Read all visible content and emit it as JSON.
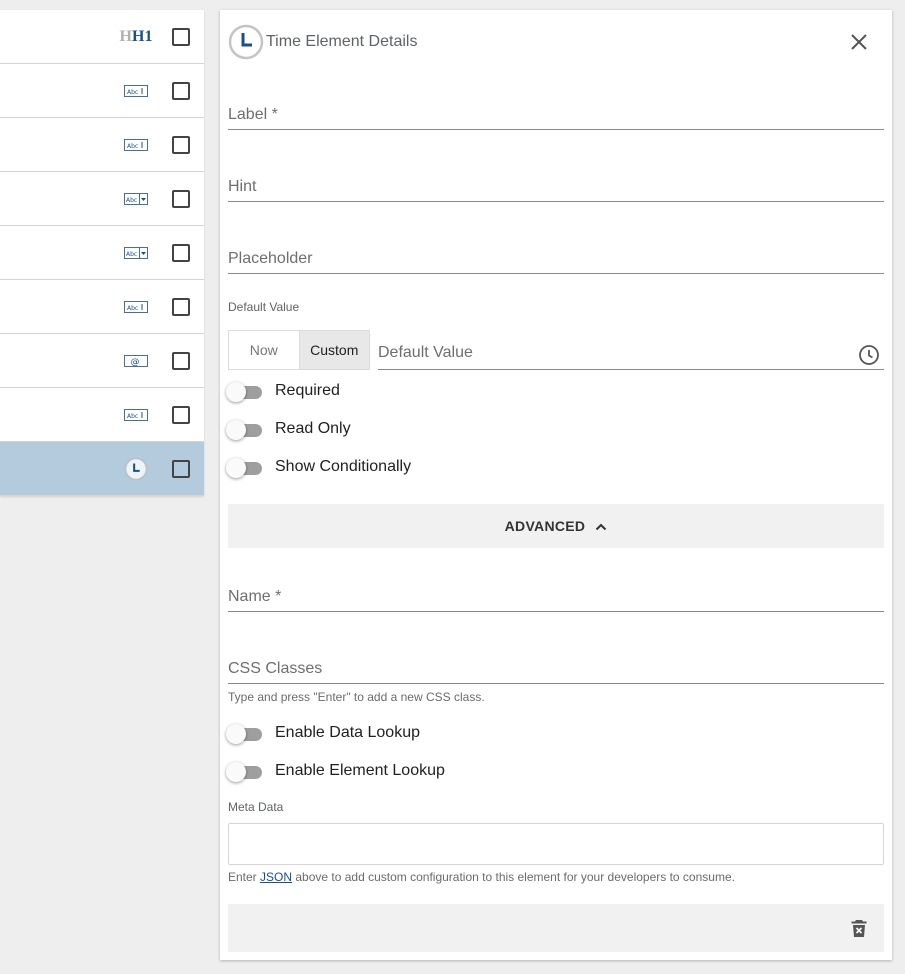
{
  "element_list": {
    "rows": [
      {
        "icon": "heading-icon",
        "heading_text": "H1",
        "selected": false
      },
      {
        "icon": "text-field-icon",
        "selected": false
      },
      {
        "icon": "text-field-icon",
        "selected": false
      },
      {
        "icon": "dropdown-field-icon",
        "selected": false
      },
      {
        "icon": "dropdown-field-icon",
        "selected": false
      },
      {
        "icon": "text-field-icon",
        "selected": false
      },
      {
        "icon": "email-field-icon",
        "selected": false
      },
      {
        "icon": "text-field-icon",
        "selected": false
      },
      {
        "icon": "clock-icon",
        "selected": true
      }
    ]
  },
  "panel": {
    "title": "Time Element Details",
    "label_placeholder": "Label *",
    "hint_placeholder": "Hint",
    "placeholder_placeholder": "Placeholder",
    "default_value_section_label": "Default Value",
    "default_value_now": "Now",
    "default_value_custom": "Custom",
    "default_value_selected": "Custom",
    "default_value_placeholder": "Default Value",
    "toggles": {
      "required": "Required",
      "read_only": "Read Only",
      "show_conditionally": "Show Conditionally"
    },
    "advanced_label": "ADVANCED",
    "name_placeholder": "Name *",
    "css_placeholder": "CSS Classes",
    "css_hint": "Type and press \"Enter\" to add a new CSS class.",
    "lookup_toggles": {
      "data_lookup": "Enable Data Lookup",
      "element_lookup": "Enable Element Lookup"
    },
    "meta_data_label": "Meta Data",
    "meta_hint_prefix": "Enter ",
    "meta_hint_link": "JSON",
    "meta_hint_suffix": " above to add custom configuration to this element for your developers to consume."
  },
  "colors": {
    "accent": "#1a4f8a",
    "selected_row": "#b3cbdc",
    "toggle_off_track": "#9e9e9e"
  }
}
